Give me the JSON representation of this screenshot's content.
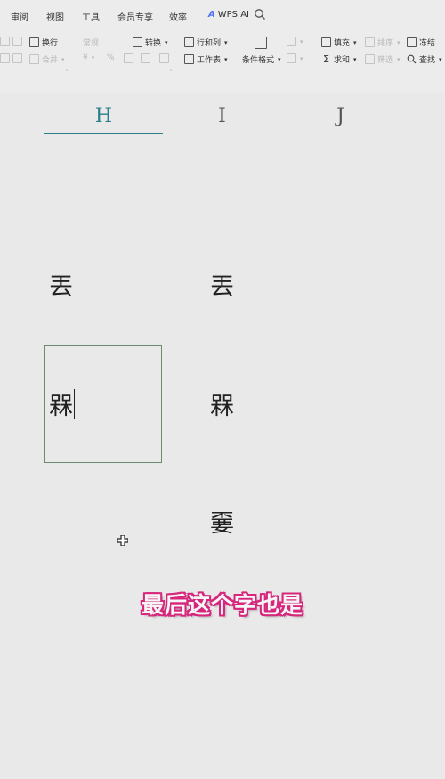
{
  "menu": {
    "tabs": [
      "审阅",
      "视图",
      "工具",
      "会员专享",
      "效率"
    ],
    "wps_ai": "WPS AI"
  },
  "toolbar": {
    "wrap_text": "换行",
    "number_format": "常规",
    "convert": "转换",
    "rows_cols": "行和列",
    "worksheet": "工作表",
    "conditional_format": "条件格式",
    "fill": "填充",
    "sum": "求和",
    "freeze": "冻结",
    "find": "查找",
    "merge": "合并",
    "sort": "排序",
    "filter": "筛选",
    "percent": "%"
  },
  "columns": [
    "H",
    "I",
    "J"
  ],
  "cells": {
    "h_row1": "丟",
    "i_row1": "丟",
    "h_row2": "槑",
    "i_row2": "槑",
    "i_row3": "嫑"
  },
  "subtitle": "最后这个字也是"
}
